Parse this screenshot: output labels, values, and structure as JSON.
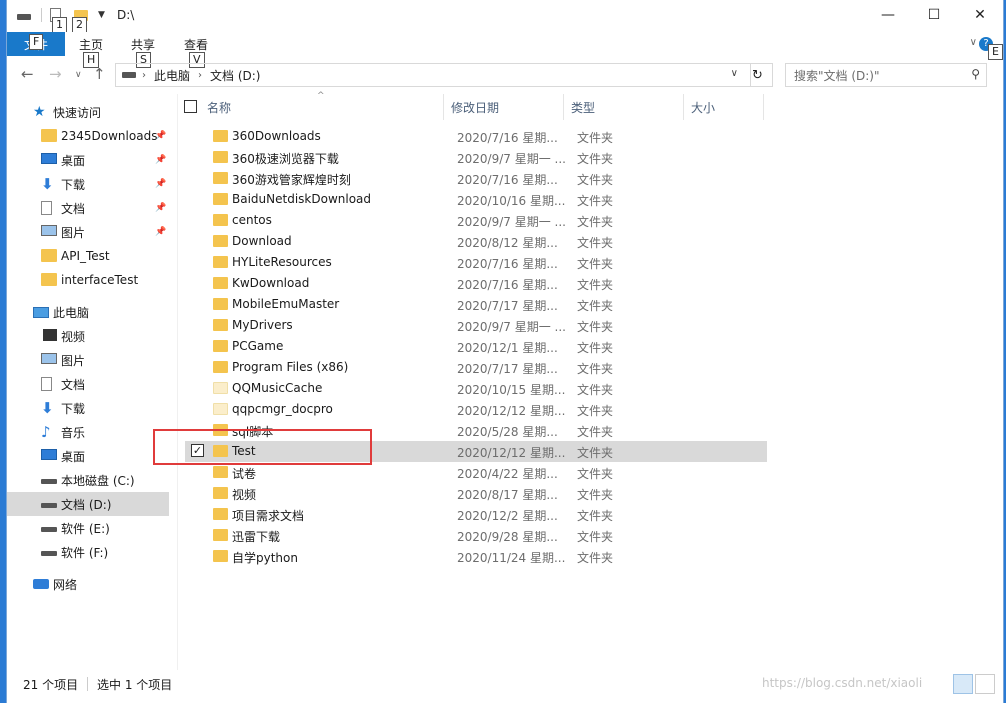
{
  "title": "D:\\",
  "keytips": {
    "qat1": "1",
    "qat2": "2",
    "file": "F",
    "home": "H",
    "share": "S",
    "view": "V",
    "help": "E"
  },
  "window_buttons": {
    "minimize": "—",
    "maximize": "☐",
    "close": "✕"
  },
  "ribbon": {
    "file_tab": "文件",
    "tabs": [
      "主页",
      "共享",
      "查看"
    ],
    "expand": "∨",
    "help": "?"
  },
  "address": {
    "crumbs": [
      "此电脑",
      "文档 (D:)"
    ],
    "dropdown": "∨",
    "refresh": "↻"
  },
  "nav_buttons": {
    "back": "←",
    "forward": "→",
    "recent": "∨",
    "up": "↑"
  },
  "search": {
    "placeholder": "搜索\"文档 (D:)\"",
    "icon": "⚲"
  },
  "sidebar": {
    "quick_access": "快速访问",
    "items": [
      {
        "label": "2345Downloads",
        "icon": "folder-icon",
        "pinned": true
      },
      {
        "label": "桌面",
        "icon": "desktop-icon",
        "pinned": true
      },
      {
        "label": "下载",
        "icon": "download-icon",
        "pinned": true
      },
      {
        "label": "文档",
        "icon": "document-icon",
        "pinned": true
      },
      {
        "label": "图片",
        "icon": "picture-icon",
        "pinned": true
      },
      {
        "label": "API_Test",
        "icon": "folder-icon",
        "pinned": false
      },
      {
        "label": "interfaceTest",
        "icon": "folder-icon",
        "pinned": false
      }
    ],
    "this_pc": "此电脑",
    "pc_items": [
      {
        "label": "视频",
        "icon": "video-icon"
      },
      {
        "label": "图片",
        "icon": "picture-icon"
      },
      {
        "label": "文档",
        "icon": "document-icon"
      },
      {
        "label": "下载",
        "icon": "download-icon"
      },
      {
        "label": "音乐",
        "icon": "music-icon"
      },
      {
        "label": "桌面",
        "icon": "desktop-icon"
      },
      {
        "label": "本地磁盘 (C:)",
        "icon": "drive-icon"
      },
      {
        "label": "文档 (D:)",
        "icon": "drive-icon",
        "selected": true
      },
      {
        "label": "软件 (E:)",
        "icon": "drive-icon"
      },
      {
        "label": "软件 (F:)",
        "icon": "drive-icon"
      }
    ],
    "network": "网络",
    "pin_glyph": "📌"
  },
  "columns": {
    "name": "名称",
    "date": "修改日期",
    "type": "类型",
    "size": "大小",
    "sort_glyph": "^"
  },
  "files": [
    {
      "name": "360Downloads",
      "date": "2020/7/16 星期...",
      "type": "文件夹"
    },
    {
      "name": "360极速浏览器下载",
      "date": "2020/9/7 星期一 ...",
      "type": "文件夹"
    },
    {
      "name": "360游戏管家辉煌时刻",
      "date": "2020/7/16 星期...",
      "type": "文件夹"
    },
    {
      "name": "BaiduNetdiskDownload",
      "date": "2020/10/16 星期...",
      "type": "文件夹"
    },
    {
      "name": "centos",
      "date": "2020/9/7 星期一 ...",
      "type": "文件夹"
    },
    {
      "name": "Download",
      "date": "2020/8/12 星期...",
      "type": "文件夹"
    },
    {
      "name": "HYLiteResources",
      "date": "2020/7/16 星期...",
      "type": "文件夹"
    },
    {
      "name": "KwDownload",
      "date": "2020/7/16 星期...",
      "type": "文件夹"
    },
    {
      "name": "MobileEmuMaster",
      "date": "2020/7/17 星期...",
      "type": "文件夹"
    },
    {
      "name": "MyDrivers",
      "date": "2020/9/7 星期一 ...",
      "type": "文件夹"
    },
    {
      "name": "PCGame",
      "date": "2020/12/1 星期...",
      "type": "文件夹"
    },
    {
      "name": "Program Files (x86)",
      "date": "2020/7/17 星期...",
      "type": "文件夹"
    },
    {
      "name": "QQMusicCache",
      "date": "2020/10/15 星期...",
      "type": "文件夹",
      "pale": true
    },
    {
      "name": "qqpcmgr_docpro",
      "date": "2020/12/12 星期...",
      "type": "文件夹",
      "pale": true
    },
    {
      "name": "sql脚本",
      "date": "2020/5/28 星期...",
      "type": "文件夹"
    },
    {
      "name": "Test",
      "date": "2020/12/12 星期...",
      "type": "文件夹",
      "selected": true
    },
    {
      "name": "试卷",
      "date": "2020/4/22 星期...",
      "type": "文件夹"
    },
    {
      "name": "视频",
      "date": "2020/8/17 星期...",
      "type": "文件夹"
    },
    {
      "name": "项目需求文档",
      "date": "2020/12/2 星期...",
      "type": "文件夹"
    },
    {
      "name": "迅雷下载",
      "date": "2020/9/28 星期...",
      "type": "文件夹"
    },
    {
      "name": "自学python",
      "date": "2020/11/24 星期...",
      "type": "文件夹"
    }
  ],
  "status": {
    "count": "21 个项目",
    "selected": "选中 1 个项目",
    "watermark": "https://blog.csdn.net/xiaoli"
  },
  "colors": {
    "accent": "#1979ca",
    "folder": "#f4c44e",
    "selection": "#d9d9d9",
    "highlight_box": "#e03b3b"
  }
}
